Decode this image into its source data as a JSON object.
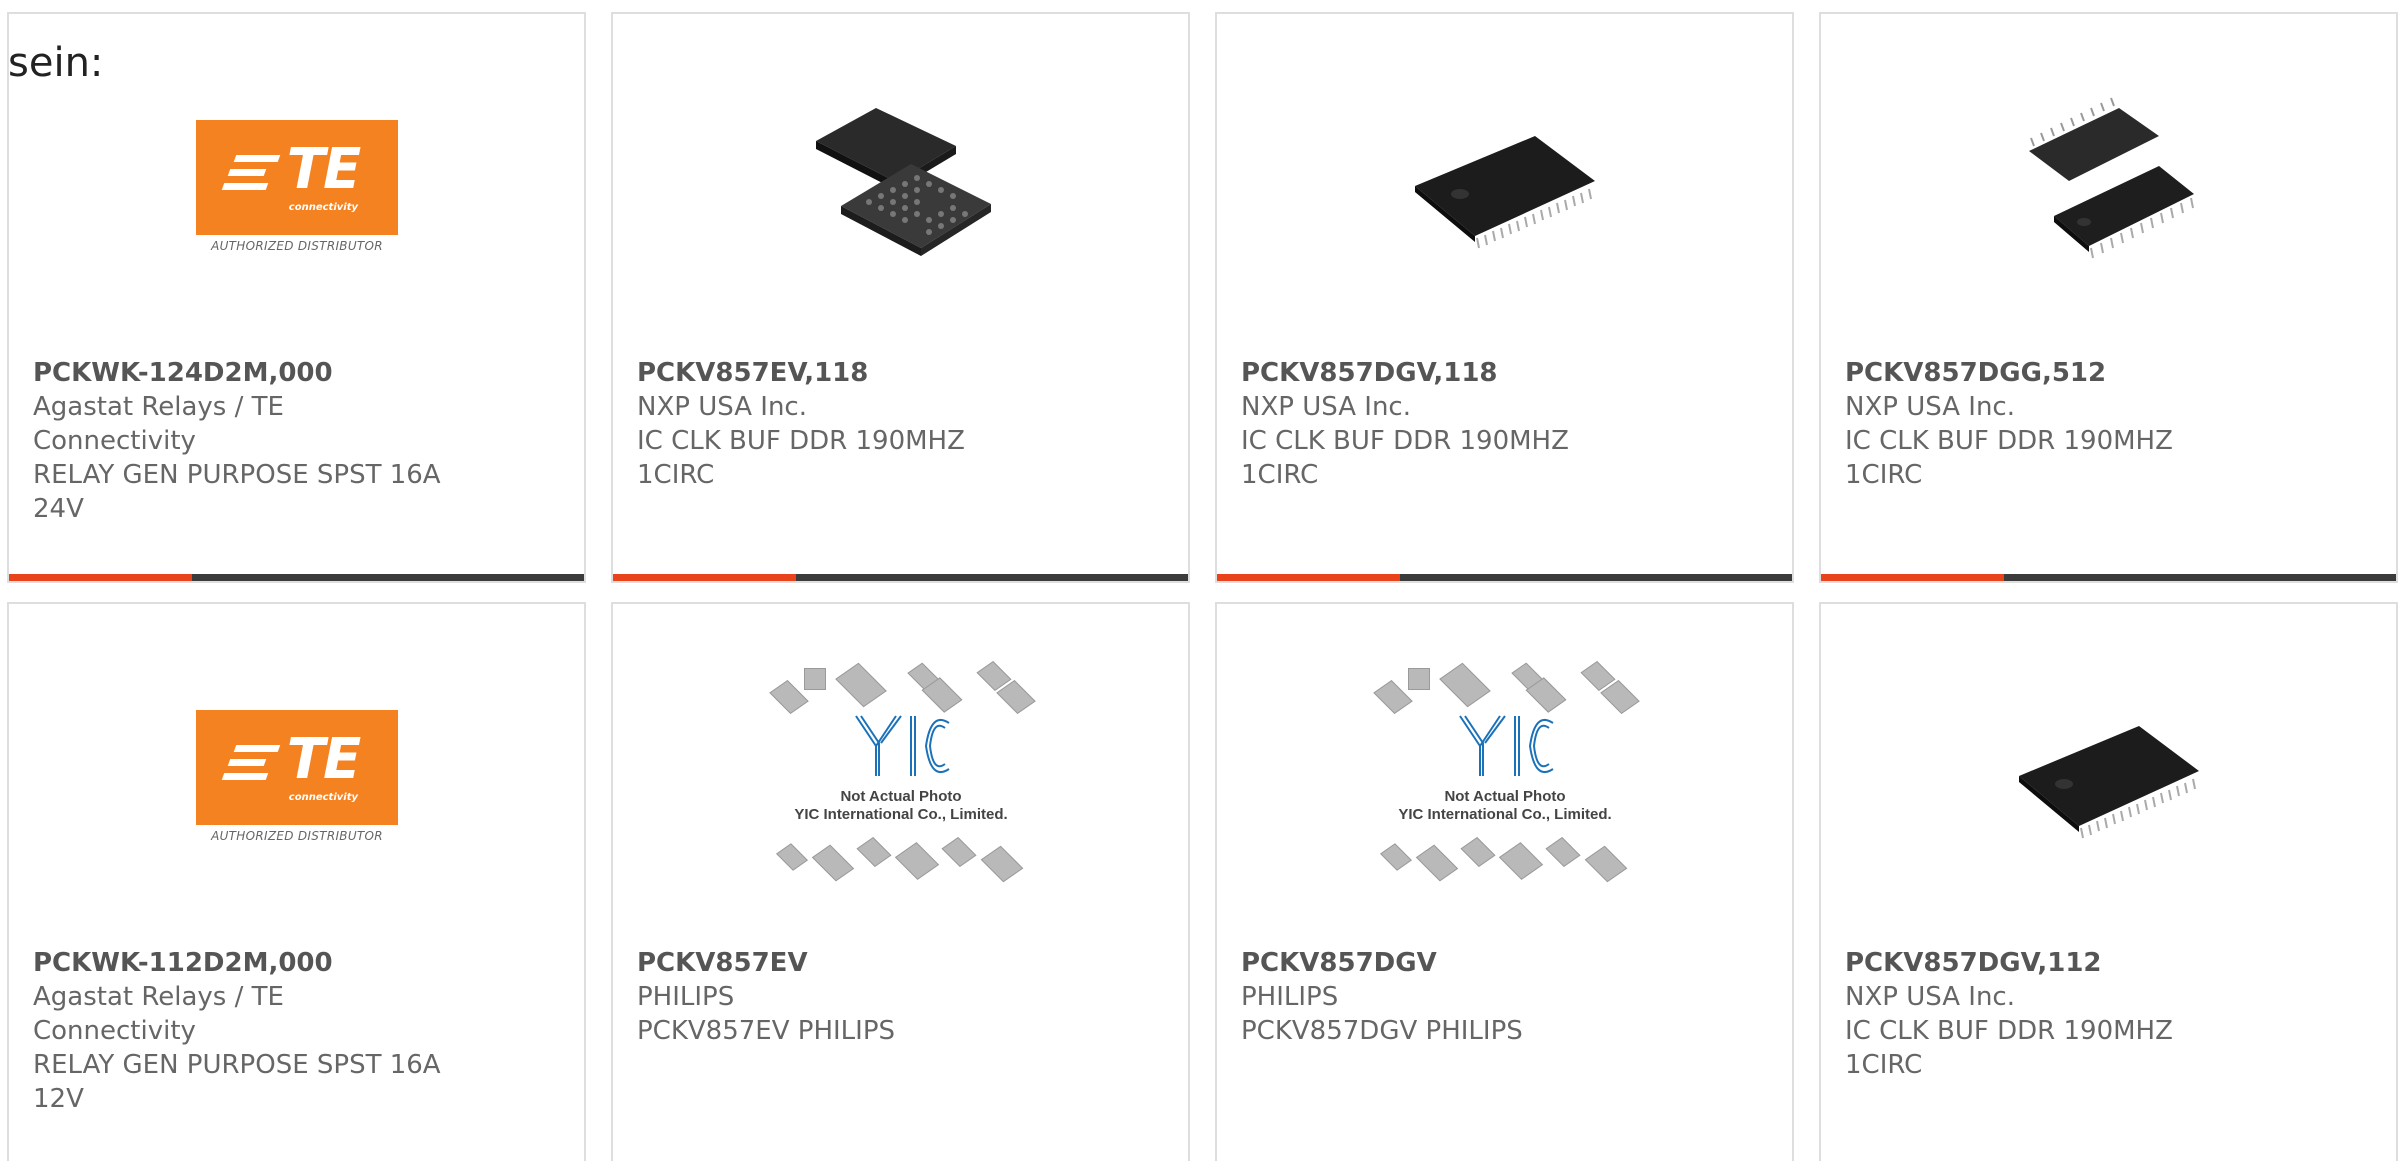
{
  "intro_text": "sein:",
  "products": [
    {
      "part_number": "PCKWK-124D2M,000",
      "manufacturer": "Agastat Relays / TE Connectivity",
      "description": "RELAY GEN PURPOSE SPST 16A 24V",
      "image": "te-logo"
    },
    {
      "part_number": "PCKV857EV,118",
      "manufacturer": "NXP USA Inc.",
      "description": "IC CLK BUF DDR 190MHZ 1CIRC",
      "image": "bga-chip"
    },
    {
      "part_number": "PCKV857DGV,118",
      "manufacturer": "NXP USA Inc.",
      "description": "IC CLK BUF DDR 190MHZ 1CIRC",
      "image": "tssop-chip"
    },
    {
      "part_number": "PCKV857DGG,512",
      "manufacturer": "NXP USA Inc.",
      "description": "IC CLK BUF DDR 190MHZ 1CIRC",
      "image": "tssop-pair-chip"
    },
    {
      "part_number": "PCKWK-112D2M,000",
      "manufacturer": "Agastat Relays / TE Connectivity",
      "description": "RELAY GEN PURPOSE SPST 16A 12V",
      "image": "te-logo"
    },
    {
      "part_number": "PCKV857EV",
      "manufacturer": "PHILIPS",
      "description": "PCKV857EV PHILIPS",
      "image": "yic-placeholder"
    },
    {
      "part_number": "PCKV857DGV",
      "manufacturer": "PHILIPS",
      "description": "PCKV857DGV PHILIPS",
      "image": "yic-placeholder"
    },
    {
      "part_number": "PCKV857DGV,112",
      "manufacturer": "NXP USA Inc.",
      "description": "IC CLK BUF DDR 190MHZ 1CIRC",
      "image": "tssop-chip"
    }
  ],
  "te_logo": {
    "wordmark": "TE",
    "sub": "connectivity",
    "caption": "AUTHORIZED DISTRIBUTOR"
  },
  "yic_placeholder": {
    "line1": "Not Actual Photo",
    "line2": "YIC International Co., Limited."
  },
  "colors": {
    "accent": "#e8431a",
    "bar": "#3b3b3b",
    "te_orange": "#f58220",
    "yic_blue": "#1b72b8"
  }
}
